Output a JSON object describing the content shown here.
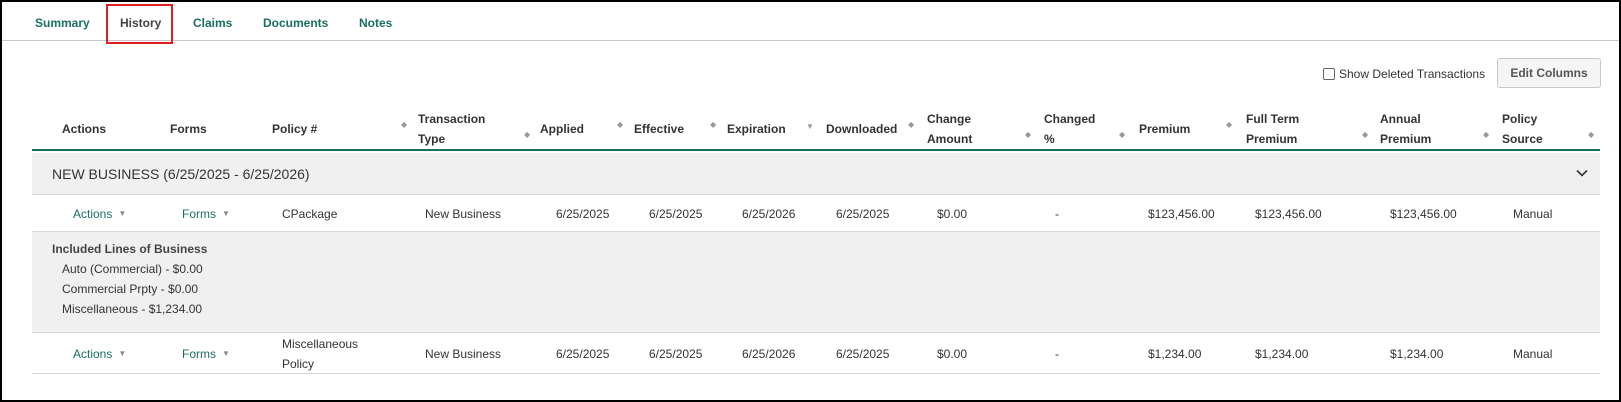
{
  "tabs": [
    {
      "label": "Summary"
    },
    {
      "label": "History"
    },
    {
      "label": "Claims"
    },
    {
      "label": "Documents"
    },
    {
      "label": "Notes"
    }
  ],
  "active_tab": "History",
  "toolbar": {
    "show_deleted_label": "Show Deleted Transactions",
    "show_deleted_checked": false,
    "edit_columns_label": "Edit Columns"
  },
  "columns": [
    {
      "line1": "Actions",
      "line2": ""
    },
    {
      "line1": "Forms",
      "line2": ""
    },
    {
      "line1": "Policy #",
      "line2": ""
    },
    {
      "line1": "Transaction",
      "line2": "Type"
    },
    {
      "line1": "Applied",
      "line2": ""
    },
    {
      "line1": "Effective",
      "line2": ""
    },
    {
      "line1": "Expiration",
      "line2": ""
    },
    {
      "line1": "Downloaded",
      "line2": ""
    },
    {
      "line1": "Change",
      "line2": "Amount"
    },
    {
      "line1": "Changed",
      "line2": "%"
    },
    {
      "line1": "Premium",
      "line2": ""
    },
    {
      "line1": "Full Term",
      "line2": "Premium"
    },
    {
      "line1": "Annual",
      "line2": "Premium"
    },
    {
      "line1": "Policy",
      "line2": "Source"
    }
  ],
  "group": {
    "title": "NEW BUSINESS (6/25/2025 - 6/25/2026)"
  },
  "rows": [
    {
      "actions": "Actions",
      "forms": "Forms",
      "policy_line1": "CPackage",
      "policy_line2": "",
      "transaction_type": "New Business",
      "applied": "6/25/2025",
      "effective": "6/25/2025",
      "expiration": "6/25/2026",
      "downloaded": "6/25/2025",
      "change_amount": "$0.00",
      "changed_pct": "-",
      "premium": "$123,456.00",
      "full_term_premium": "$123,456.00",
      "annual_premium": "$123,456.00",
      "policy_source": "Manual"
    },
    {
      "actions": "Actions",
      "forms": "Forms",
      "policy_line1": "Miscellaneous",
      "policy_line2": "Policy",
      "transaction_type": "New Business",
      "applied": "6/25/2025",
      "effective": "6/25/2025",
      "expiration": "6/25/2026",
      "downloaded": "6/25/2025",
      "change_amount": "$0.00",
      "changed_pct": "-",
      "premium": "$1,234.00",
      "full_term_premium": "$1,234.00",
      "annual_premium": "$1,234.00",
      "policy_source": "Manual"
    }
  ],
  "lines_of_business": {
    "title": "Included Lines of Business",
    "items": [
      "Auto (Commercial) - $0.00",
      "Commercial Prpty - $0.00",
      "Miscellaneous - $1,234.00"
    ]
  },
  "colors": {
    "accent": "#1a6f63",
    "highlight": "#e02020",
    "band": "#f0f0f0"
  },
  "icons": {
    "sort": "sort-icon",
    "caret": "caret-down-icon",
    "chevron": "chevron-down-icon",
    "checkbox": "checkbox-icon"
  }
}
